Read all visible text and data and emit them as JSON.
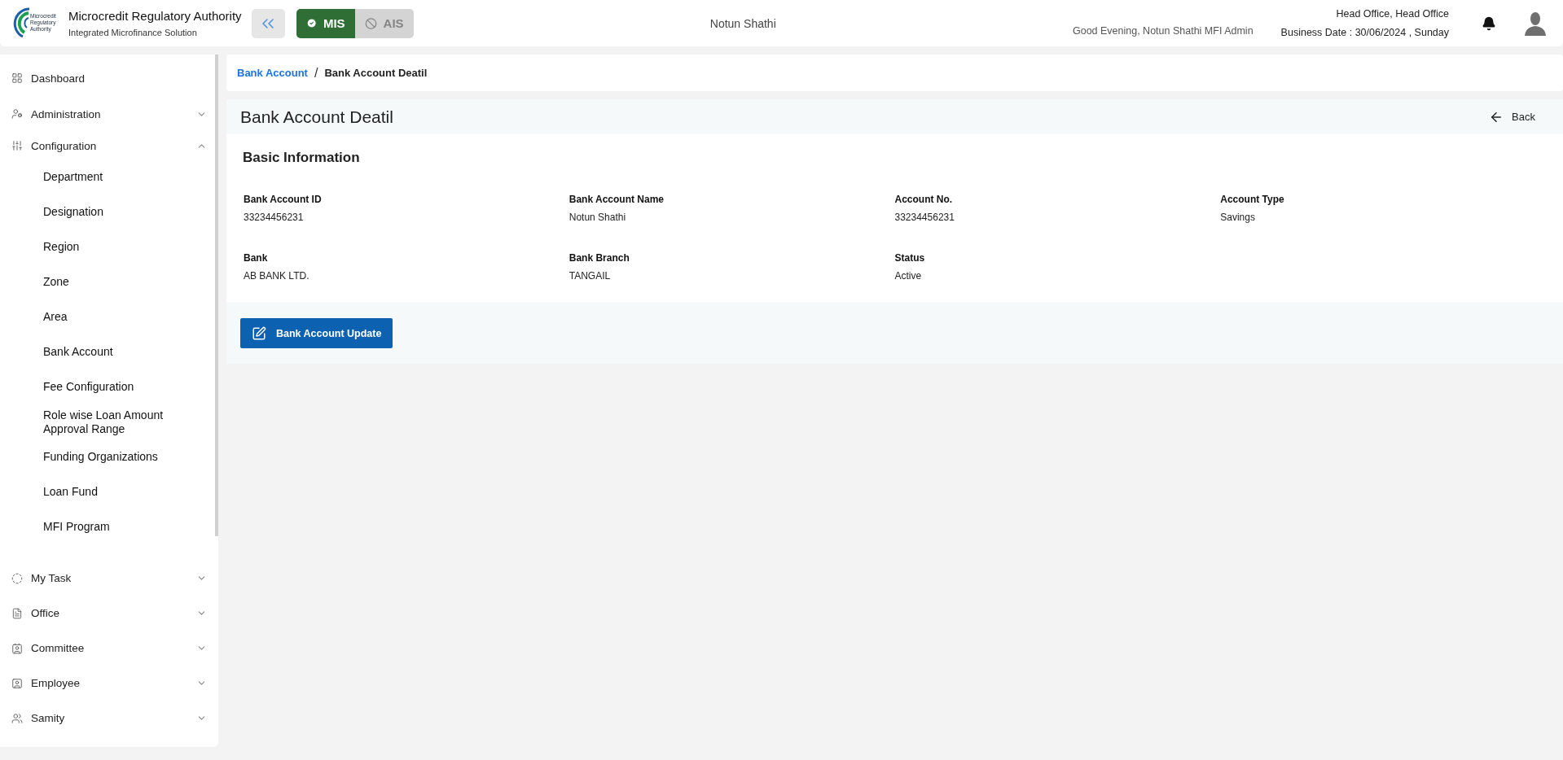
{
  "header": {
    "logo_lines": [
      "Microcredit",
      "Regulatory",
      "Authority"
    ],
    "title": "Microcredit Regulatory Authority",
    "subtitle": "Integrated Microfinance Solution",
    "modules": [
      {
        "label": "MIS",
        "selected": true
      },
      {
        "label": "AIS",
        "selected": false
      }
    ],
    "org_name": "Notun Shathi",
    "greeting": "Good Evening, Notun Shathi MFI Admin",
    "office": "Head Office, Head Office",
    "business_date": "Business Date : 30/06/2024 , Sunday"
  },
  "sidebar": {
    "items": [
      {
        "label": "Dashboard",
        "kind": "link"
      },
      {
        "label": "Administration",
        "kind": "group",
        "expanded": false
      },
      {
        "label": "Configuration",
        "kind": "group",
        "expanded": true,
        "children": [
          {
            "label": "Department"
          },
          {
            "label": "Designation"
          },
          {
            "label": "Region"
          },
          {
            "label": "Zone"
          },
          {
            "label": "Area"
          },
          {
            "label": "Bank Account"
          },
          {
            "label": "Fee Configuration"
          },
          {
            "label": "Role wise Loan Amount Approval Range"
          },
          {
            "label": "Funding Organizations"
          },
          {
            "label": "Loan Fund"
          },
          {
            "label": "MFI Program"
          }
        ]
      },
      {
        "label": "My Task",
        "kind": "group",
        "expanded": false
      },
      {
        "label": "Office",
        "kind": "group",
        "expanded": false
      },
      {
        "label": "Committee",
        "kind": "group",
        "expanded": false
      },
      {
        "label": "Employee",
        "kind": "group",
        "expanded": false
      },
      {
        "label": "Samity",
        "kind": "group",
        "expanded": false
      }
    ]
  },
  "breadcrumb": [
    {
      "label": "Bank Account",
      "kind": "link"
    },
    {
      "label": "/",
      "kind": "separator"
    },
    {
      "label": "Bank Account Deatil",
      "kind": "current"
    }
  ],
  "page": {
    "title": "Bank Account Deatil",
    "back": "Back",
    "section_title": "Basic Information",
    "fields": [
      {
        "label": "Bank Account ID",
        "value": "33234456231"
      },
      {
        "label": "Bank Account Name",
        "value": "Notun Shathi"
      },
      {
        "label": "Account No.",
        "value": "33234456231"
      },
      {
        "label": "Account Type",
        "value": "Savings"
      },
      {
        "label": "Bank",
        "value": "AB BANK LTD."
      },
      {
        "label": "Bank Branch",
        "value": "TANGAIL"
      },
      {
        "label": "Status",
        "value": "Active"
      }
    ],
    "button": "Bank Account Update"
  }
}
